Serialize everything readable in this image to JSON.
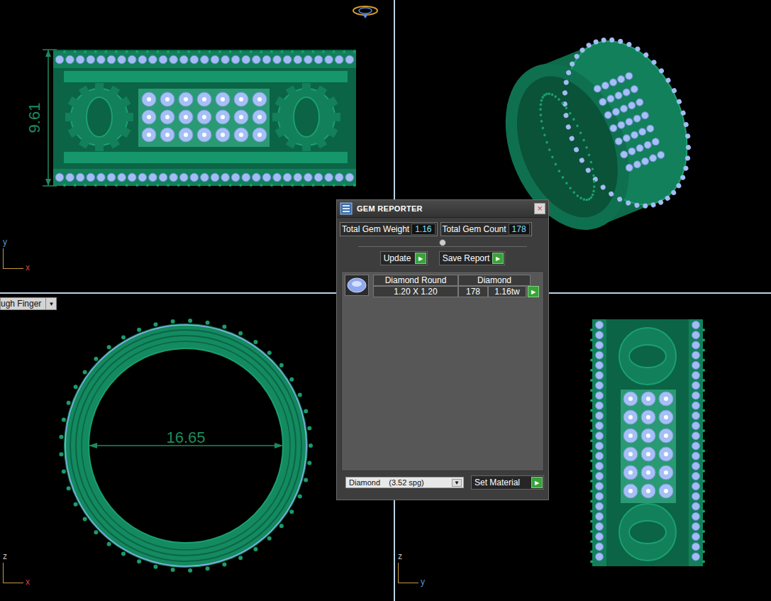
{
  "viewports": [
    {
      "view": "front",
      "dimension": "9.61",
      "axes": [
        {
          "label": "y",
          "color": "#5b8fd8"
        },
        {
          "label": "x",
          "color": "#d9413a"
        }
      ]
    },
    {
      "view": "perspective",
      "dimension": "",
      "axes": []
    },
    {
      "view": "top",
      "dimension": "16.65",
      "axes": [
        {
          "label": "z",
          "color": "#c9c9c9"
        },
        {
          "label": "x",
          "color": "#d9413a"
        }
      ]
    },
    {
      "view": "side",
      "dimension": "",
      "axes": [
        {
          "label": "z",
          "color": "#c9c9c9"
        },
        {
          "label": "y",
          "color": "#5b8fd8"
        }
      ]
    }
  ],
  "view_menu": {
    "label": "ugh Finger",
    "arrow": "▼"
  },
  "gem_reporter": {
    "title": "GEM REPORTER",
    "close": "×",
    "total_weight": {
      "label": "Total Gem Weight",
      "value": "1.16"
    },
    "total_count": {
      "label": "Total Gem Count",
      "value": "178"
    },
    "buttons": [
      {
        "label": "Update",
        "arrow": "▶"
      },
      {
        "label": "Save Report",
        "arrow": "▶"
      }
    ],
    "gems": [
      {
        "shape": "Diamond Round",
        "size": "1.20 X 1.20",
        "material": "Diamond",
        "count": "178",
        "weight": "1.16tw",
        "arrow": "▶"
      }
    ],
    "material_select": {
      "value": "Diamond    (3.52 spg)",
      "arrow": "▼"
    },
    "set_material": {
      "label": "Set Material",
      "arrow": "▶"
    }
  }
}
